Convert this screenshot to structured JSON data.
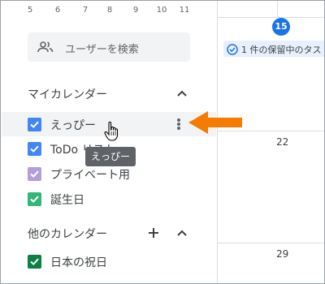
{
  "mini_calendar": {
    "days": [
      "5",
      "6",
      "7",
      "8",
      "9",
      "10",
      "11"
    ]
  },
  "search": {
    "label": "ユーザーを検索",
    "icon": "people-icon"
  },
  "my_calendars": {
    "header": "マイカレンダー",
    "items": [
      {
        "label": "えっぴー",
        "color": "#4285f4",
        "checked": true
      },
      {
        "label": "ToDo リスト",
        "color": "#4285f4",
        "checked": true
      },
      {
        "label": "プライベート用",
        "color": "#b39ddb",
        "checked": true
      },
      {
        "label": "誕生日",
        "color": "#33b679",
        "checked": true
      }
    ]
  },
  "other_calendars": {
    "header": "他のカレンダー",
    "items": [
      {
        "label": "日本の祝日",
        "color": "#0b8043",
        "checked": true
      }
    ]
  },
  "tooltip": {
    "text": "えっぴー"
  },
  "main": {
    "today_date": "15",
    "pending_chip": "1 件の保留中のタス",
    "week2_date": "22",
    "week3_date": "29"
  },
  "colors": {
    "accent": "#1a73e8",
    "arrow": "#f57c00"
  }
}
